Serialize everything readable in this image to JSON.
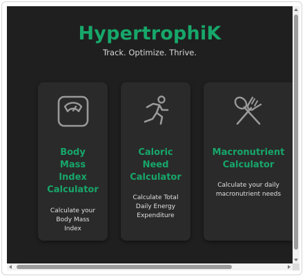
{
  "header": {
    "brand": "HypertrophiK",
    "tagline": "Track. Optimize. Thrive."
  },
  "cards": [
    {
      "icon": "scale-icon",
      "title": "Body Mass Index Calculator",
      "title_lines": [
        "Body",
        "Mass",
        "Index",
        "Calculator"
      ],
      "description_lines": [
        "Calculate your",
        "Body Mass",
        "Index"
      ]
    },
    {
      "icon": "running-person-icon",
      "title": "Caloric Need Calculator",
      "title_lines": [
        "Caloric",
        "Need",
        "Calculator"
      ],
      "description_lines": [
        "Calculate Total",
        "Daily Energy",
        "Expenditure"
      ]
    },
    {
      "icon": "fork-spoon-icon",
      "title": "Macronutrient Calculator",
      "title_lines": [
        "Macronutrient",
        "Calculator"
      ],
      "description_lines": [
        "Calculate your daily",
        "macronutrient needs"
      ]
    }
  ],
  "colors": {
    "accent": "#17a76a",
    "background": "#1f1f1f",
    "card": "#2a2a2a",
    "icon": "#9a9a9a"
  }
}
